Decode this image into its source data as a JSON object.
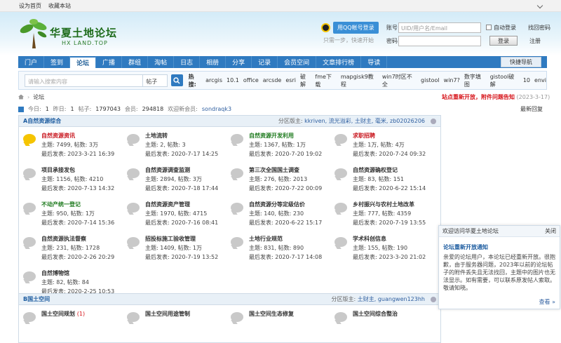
{
  "topbar": {
    "set_home": "设为首页",
    "bookmark": "收藏本站"
  },
  "logo": {
    "title": "华夏土地论坛",
    "sub": "HX LAND.TOP"
  },
  "qq": {
    "button": "用QQ帐号登录",
    "hint": "只需一步，快速开始"
  },
  "login": {
    "user_label": "账号",
    "user_placeholder": "UID/用户名/Email",
    "auto_login": "自动登录",
    "find_pwd": "找回密码",
    "pwd_label": "密码",
    "login_btn": "登录",
    "register": "注册"
  },
  "nav": {
    "items": [
      "门户",
      "签到",
      "论坛",
      "广播",
      "群组",
      "淘帖",
      "日志",
      "相册",
      "分享",
      "记录",
      "会员空间",
      "文章排行榜",
      "导读"
    ],
    "active": "论坛",
    "quick": "快捷导航"
  },
  "search": {
    "placeholder": "请输入搜索内容",
    "type": "帖子",
    "hot_label": "热搜:",
    "hot": [
      "arcgis",
      "10.1",
      "office",
      "arcsde",
      "esri",
      "破解",
      "fme下载",
      "mapgisk9教程",
      "win7时区不全",
      "gistool",
      "win7?",
      "数字填图",
      "gistool破解",
      "10",
      "envi"
    ]
  },
  "breadcrumb": {
    "current": "论坛"
  },
  "notice": {
    "title": "站点重新开放，附件问题告知",
    "date": "(2023-3-17)"
  },
  "stats": {
    "today_label": "今日:",
    "today": "1",
    "yesterday_label": "昨日:",
    "yesterday": "1",
    "posts_label": "帖子:",
    "posts": "1797043",
    "members_label": "会员:",
    "members": "294818",
    "welcome_label": "欢迎新会员:",
    "newest": "sondraqk3",
    "latest": "最新回复"
  },
  "sections": [
    {
      "title": "A自然资源综合",
      "mods_label": "分区版主:",
      "mods": "kkriven, 流光溢彩, 土财主, 毫米, zb02026206",
      "forums": [
        {
          "name": "自然资源资讯",
          "color": "r",
          "icon": "new",
          "themes": "主题: 7499, 帖数: 3万",
          "last": "最后发表: 2023-3-21 16:39"
        },
        {
          "name": "土地流转",
          "color": "",
          "icon": "",
          "themes": "主题: 2, 帖数: 3",
          "last": "最后发表: 2020-7-17 14:25"
        },
        {
          "name": "自然资源开发利用",
          "color": "g",
          "icon": "",
          "themes": "主题: 1367, 帖数: 1万",
          "last": "最后发表: 2020-7-20 19:02"
        },
        {
          "name": "求职招聘",
          "color": "r",
          "icon": "",
          "themes": "主题: 1万, 帖数: 4万",
          "last": "最后发表: 2020-7-24 09:32"
        },
        {
          "name": "项目承接发包",
          "color": "",
          "icon": "",
          "themes": "主题: 1156, 帖数: 4210",
          "last": "最后发表: 2020-7-13 14:32"
        },
        {
          "name": "自然资源调查监测",
          "color": "",
          "icon": "",
          "themes": "主题: 2894, 帖数: 3万",
          "last": "最后发表: 2020-7-18 17:44"
        },
        {
          "name": "第三次全国国土调查",
          "color": "",
          "icon": "",
          "themes": "主题: 276, 帖数: 2013",
          "last": "最后发表: 2020-7-22 00:09"
        },
        {
          "name": "自然资源确权登记",
          "color": "",
          "icon": "",
          "themes": "主题: 83, 帖数: 151",
          "last": "最后发表: 2020-6-22 15:14"
        },
        {
          "name": "不动产统一登记",
          "color": "g",
          "icon": "",
          "themes": "主题: 950, 帖数: 1万",
          "last": "最后发表: 2020-7-14 15:36"
        },
        {
          "name": "自然资源资产管理",
          "color": "",
          "icon": "",
          "themes": "主题: 1970, 帖数: 4715",
          "last": "最后发表: 2020-7-16 08:41"
        },
        {
          "name": "自然资源分等定级估价",
          "color": "",
          "icon": "",
          "themes": "主题: 140, 帖数: 230",
          "last": "最后发表: 2020-6-22 15:17"
        },
        {
          "name": "乡村振兴与农村土地改革",
          "color": "",
          "icon": "",
          "themes": "主题: 777, 帖数: 4359",
          "last": "最后发表: 2020-7-19 13:55"
        },
        {
          "name": "自然资源执法督察",
          "color": "",
          "icon": "",
          "themes": "主题: 231, 帖数: 1728",
          "last": "最后发表: 2020-2-26 20:29"
        },
        {
          "name": "招投标施工验收管理",
          "color": "",
          "icon": "",
          "themes": "主题: 1409, 帖数: 1万",
          "last": "最后发表: 2020-7-19 13:52"
        },
        {
          "name": "土地行业规范",
          "color": "",
          "icon": "",
          "themes": "主题: 831, 帖数: 890",
          "last": "最后发表: 2020-7-17 14:08"
        },
        {
          "name": "学术科创信息",
          "color": "",
          "icon": "",
          "themes": "主题: 155, 帖数: 190",
          "last": "最后发表: 2023-3-20 21:02"
        },
        {
          "name": "自然博物馆",
          "color": "",
          "icon": "",
          "themes": "主题: 82, 帖数: 84",
          "last": "最后发表: 2020-2-25 10:53"
        }
      ]
    },
    {
      "title": "B国土空间",
      "mods_label": "分区版主:",
      "mods": "土财主, guangwen123hh",
      "forums": [
        {
          "name": "国土空间规划",
          "count": "(1)",
          "color": "",
          "icon": "",
          "themes": "",
          "last": ""
        },
        {
          "name": "国土空间用途管制",
          "color": "",
          "icon": "",
          "themes": "",
          "last": ""
        },
        {
          "name": "国土空间生态修复",
          "color": "",
          "icon": "",
          "themes": "",
          "last": ""
        },
        {
          "name": "国土空间综合整治",
          "color": "",
          "icon": "",
          "themes": "",
          "last": ""
        }
      ]
    }
  ],
  "welcome": {
    "header": "欢迎访问华夏土地论坛",
    "close": "关闭",
    "title": "论坛重新开放通知",
    "body": "亲爱的论坛用户，本论坛已经重新开放。很抱歉，由于服务器问题，2023年以前的论坛帖子的附件丢失且无法找回，主题中的图片也无法显示。如有需要，可以联系原发帖人索取。敬请知晓。",
    "more": "查看 »"
  }
}
